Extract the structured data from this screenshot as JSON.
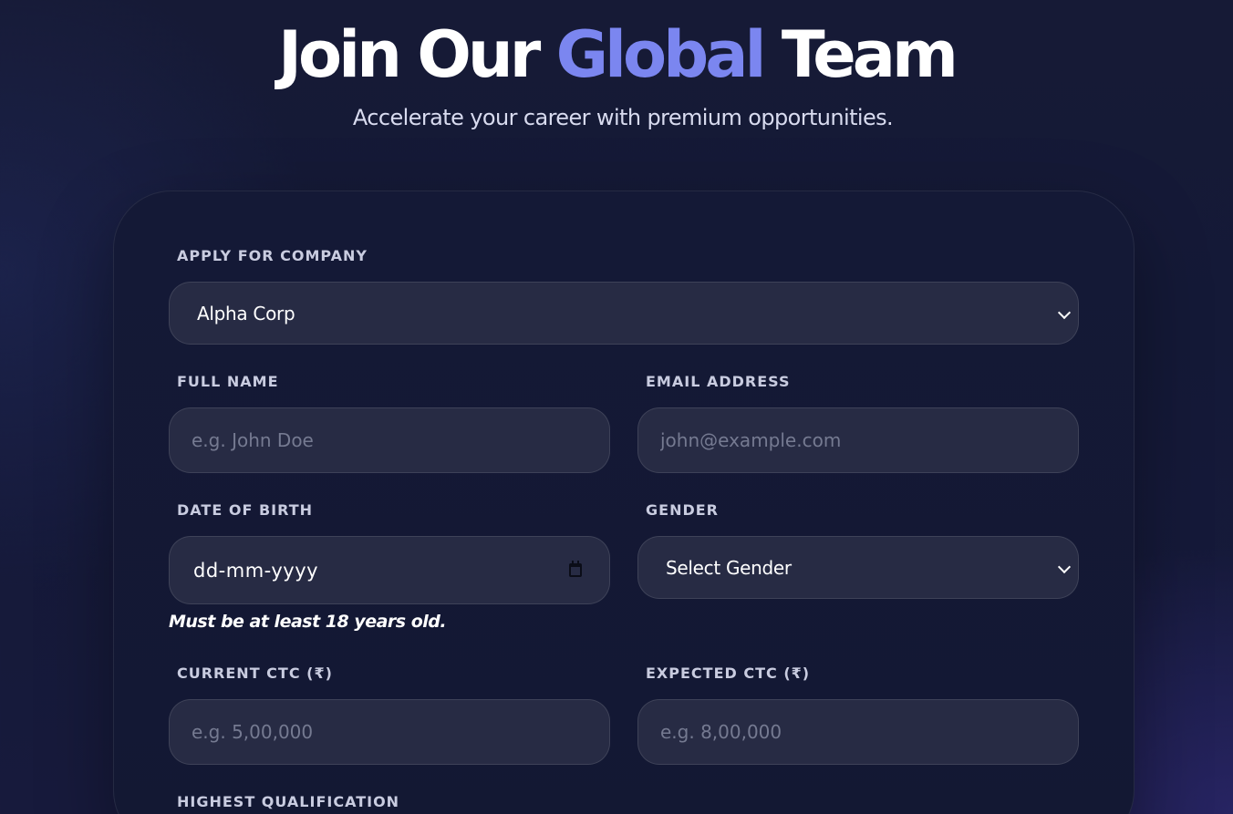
{
  "hero": {
    "title_part1": "Join Our",
    "title_accent": "Global",
    "title_part2": "Team",
    "subtitle": "Accelerate your career with premium opportunities."
  },
  "form": {
    "company": {
      "label": "APPLY FOR COMPANY",
      "selected": "Alpha Corp"
    },
    "full_name": {
      "label": "FULL NAME",
      "placeholder": "e.g. John Doe",
      "value": ""
    },
    "email": {
      "label": "EMAIL ADDRESS",
      "placeholder": "john@example.com",
      "value": ""
    },
    "dob": {
      "label": "DATE OF BIRTH",
      "display": "dd-mm-yyyy",
      "hint": "Must be at least 18 years old."
    },
    "gender": {
      "label": "GENDER",
      "selected": "Select Gender"
    },
    "current_ctc": {
      "label": "CURRENT CTC (₹)",
      "placeholder": "e.g. 5,00,000",
      "value": ""
    },
    "expected_ctc": {
      "label": "EXPECTED CTC (₹)",
      "placeholder": "e.g. 8,00,000",
      "value": ""
    },
    "qualification": {
      "label": "HIGHEST QUALIFICATION"
    }
  },
  "theme": {
    "accent": "#7b86f0",
    "background": "#151a38",
    "field_background": "#272b44"
  },
  "icons": {
    "select_chevron": "chevron-down-icon",
    "date_picker": "calendar-icon"
  }
}
